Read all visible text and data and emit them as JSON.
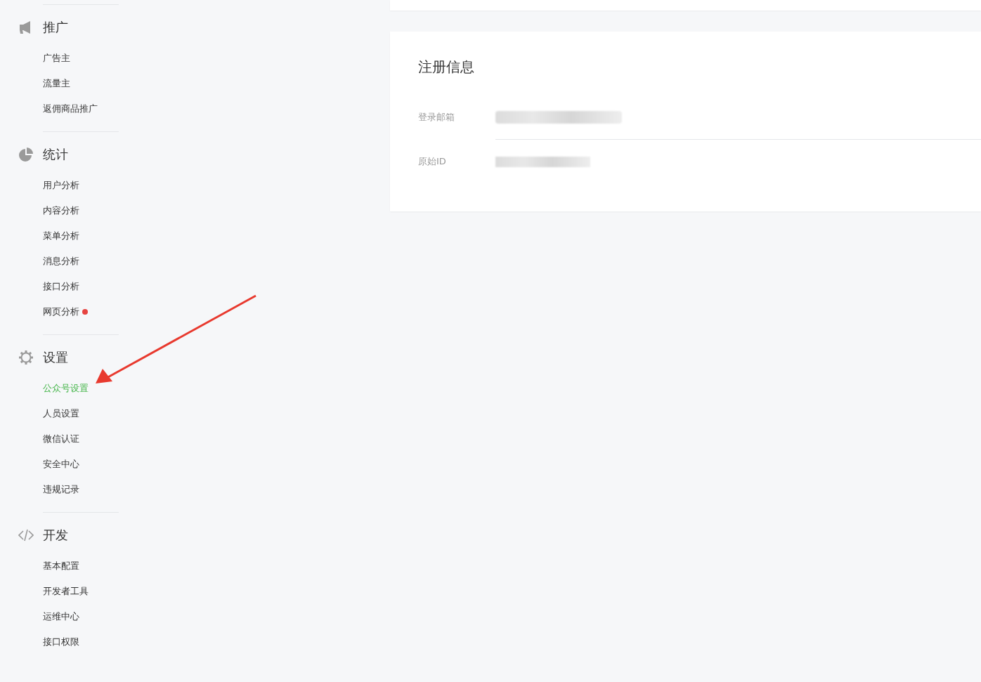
{
  "sidebar": {
    "sections": [
      {
        "kind": "megaphone",
        "title": "推广",
        "items": [
          {
            "label": "广告主",
            "selected": false,
            "new_dot": false
          },
          {
            "label": "流量主",
            "selected": false,
            "new_dot": false
          },
          {
            "label": "返佣商品推广",
            "selected": false,
            "new_dot": false
          }
        ]
      },
      {
        "kind": "pie",
        "title": "统计",
        "items": [
          {
            "label": "用户分析",
            "selected": false,
            "new_dot": false
          },
          {
            "label": "内容分析",
            "selected": false,
            "new_dot": false
          },
          {
            "label": "菜单分析",
            "selected": false,
            "new_dot": false
          },
          {
            "label": "消息分析",
            "selected": false,
            "new_dot": false
          },
          {
            "label": "接口分析",
            "selected": false,
            "new_dot": false
          },
          {
            "label": "网页分析",
            "selected": false,
            "new_dot": true
          }
        ]
      },
      {
        "kind": "gear",
        "title": "设置",
        "items": [
          {
            "label": "公众号设置",
            "selected": true,
            "new_dot": false
          },
          {
            "label": "人员设置",
            "selected": false,
            "new_dot": false
          },
          {
            "label": "微信认证",
            "selected": false,
            "new_dot": false
          },
          {
            "label": "安全中心",
            "selected": false,
            "new_dot": false
          },
          {
            "label": "违规记录",
            "selected": false,
            "new_dot": false
          }
        ]
      },
      {
        "kind": "code",
        "title": "开发",
        "items": [
          {
            "label": "基本配置",
            "selected": false,
            "new_dot": false
          },
          {
            "label": "开发者工具",
            "selected": false,
            "new_dot": false
          },
          {
            "label": "运维中心",
            "selected": false,
            "new_dot": false
          },
          {
            "label": "接口权限",
            "selected": false,
            "new_dot": false
          }
        ]
      }
    ]
  },
  "registration": {
    "title": "注册信息",
    "fields": [
      {
        "label": "登录邮箱",
        "redacted": true
      },
      {
        "label": "原始ID",
        "redacted": true
      }
    ]
  },
  "annotations": [
    {
      "kind": "arrow"
    }
  ]
}
